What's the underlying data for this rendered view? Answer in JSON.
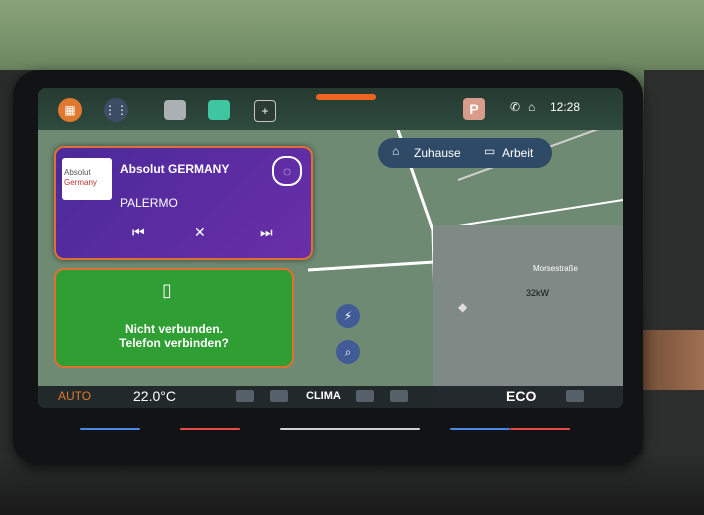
{
  "topbar": {
    "parking_label": "P",
    "clock": "12:28"
  },
  "radio": {
    "logo_line1": "Absolut",
    "logo_line2": "Germany",
    "station": "Absolut GERMANY",
    "song": "PALERMO"
  },
  "phone": {
    "line1": "Nicht verbunden.",
    "line2": "Telefon verbinden?"
  },
  "nav": {
    "home": "Zuhause",
    "work": "Arbeit"
  },
  "map": {
    "street": "Morsestraße",
    "charger": "32kW"
  },
  "climate": {
    "auto": "AUTO",
    "temp": "22.0°C",
    "clima": "CLIMA",
    "eco": "ECO"
  },
  "colors": {
    "accent": "#e07030",
    "radio_bg": "#5a2aa0",
    "phone_bg": "#2f9e33"
  }
}
